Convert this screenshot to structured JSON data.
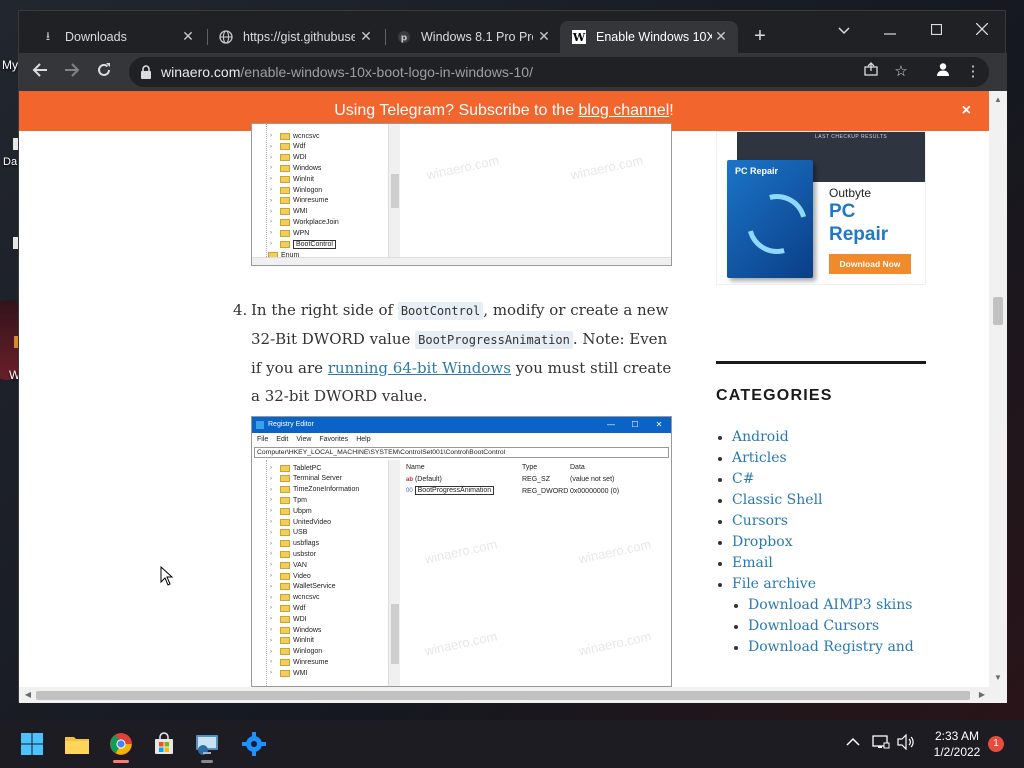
{
  "desktop": {
    "icon_labels": [
      "My",
      "Da",
      "W"
    ]
  },
  "browser": {
    "tabs": [
      {
        "title": "Downloads",
        "icon": "download-icon"
      },
      {
        "title": "https://gist.githubuse",
        "icon": "globe-icon"
      },
      {
        "title": "Windows 8.1 Pro Pro",
        "icon": "pinterest-icon"
      },
      {
        "title": "Enable Windows 10X",
        "icon": "winaero-icon",
        "favicon_letter": "W",
        "active": true
      }
    ],
    "new_tab_label": "+",
    "url_domain": "winaero.com",
    "url_path": "/enable-windows-10x-boot-logo-in-windows-10/"
  },
  "banner": {
    "text_before": "Using Telegram? Subscribe to the ",
    "link_text": "blog channel",
    "text_after": "!",
    "close_label": "×",
    "color": "#f2652d"
  },
  "step": {
    "number": "4.",
    "text_1": "In the right side of ",
    "code_1": "BootControl",
    "text_2": ", modify or create a new 32-Bit DWORD value ",
    "code_2": "BootProgressAnimation",
    "text_3": ". Note: Even if you are ",
    "link": "running 64-bit Windows",
    "text_4": " you must still create a 32-bit DWORD value."
  },
  "screenshot_top": {
    "tree": [
      "wcncsvc",
      "Wdf",
      "WDI",
      "Windows",
      "Winlnit",
      "Winlogon",
      "Winresume",
      "WMI",
      "WorkplaceJoin",
      "WPN",
      "BootControl"
    ],
    "parent": "Enum",
    "watermark": "winaero.com"
  },
  "screenshot_reg": {
    "title": "Registry Editor",
    "menu": [
      "File",
      "Edit",
      "View",
      "Favorites",
      "Help"
    ],
    "address": "Computer\\HKEY_LOCAL_MACHINE\\SYSTEM\\ControlSet001\\Control\\BootControl",
    "tree": [
      "TabletPC",
      "Terminal Server",
      "TimeZoneInformation",
      "Tpm",
      "Ubpm",
      "UnitedVideo",
      "USB",
      "usbflags",
      "usbstor",
      "VAN",
      "Video",
      "WalletService",
      "wcncsvc",
      "Wdf",
      "WDI",
      "Windows",
      "Winlnit",
      "Winlogon",
      "Winresume",
      "WMI"
    ],
    "columns": [
      "Name",
      "Type",
      "Data"
    ],
    "values": [
      {
        "name": "(Default)",
        "type": "REG_SZ",
        "data": "(value not set)"
      },
      {
        "name": "BootProgressAnimation",
        "type": "REG_DWORD",
        "data": "0x00000000 (0)"
      }
    ],
    "watermark": "winaero.com"
  },
  "ad": {
    "screen_text": "LAST CHECKUP RESULTS",
    "box_title": "PC Repair",
    "brand": "Outbyte",
    "product": "PC Repair",
    "cta": "Download Now"
  },
  "sidebar": {
    "heading": "CATEGORIES",
    "categories": [
      "Android",
      "Articles",
      "C#",
      "Classic Shell",
      "Cursors",
      "Dropbox",
      "Email",
      "File archive"
    ],
    "subcategories": [
      "Download AIMP3 skins",
      "Download Cursors",
      "Download Registry and"
    ]
  },
  "taskbar": {
    "time": "2:33 AM",
    "date": "1/2/2022",
    "notifications": "1"
  }
}
